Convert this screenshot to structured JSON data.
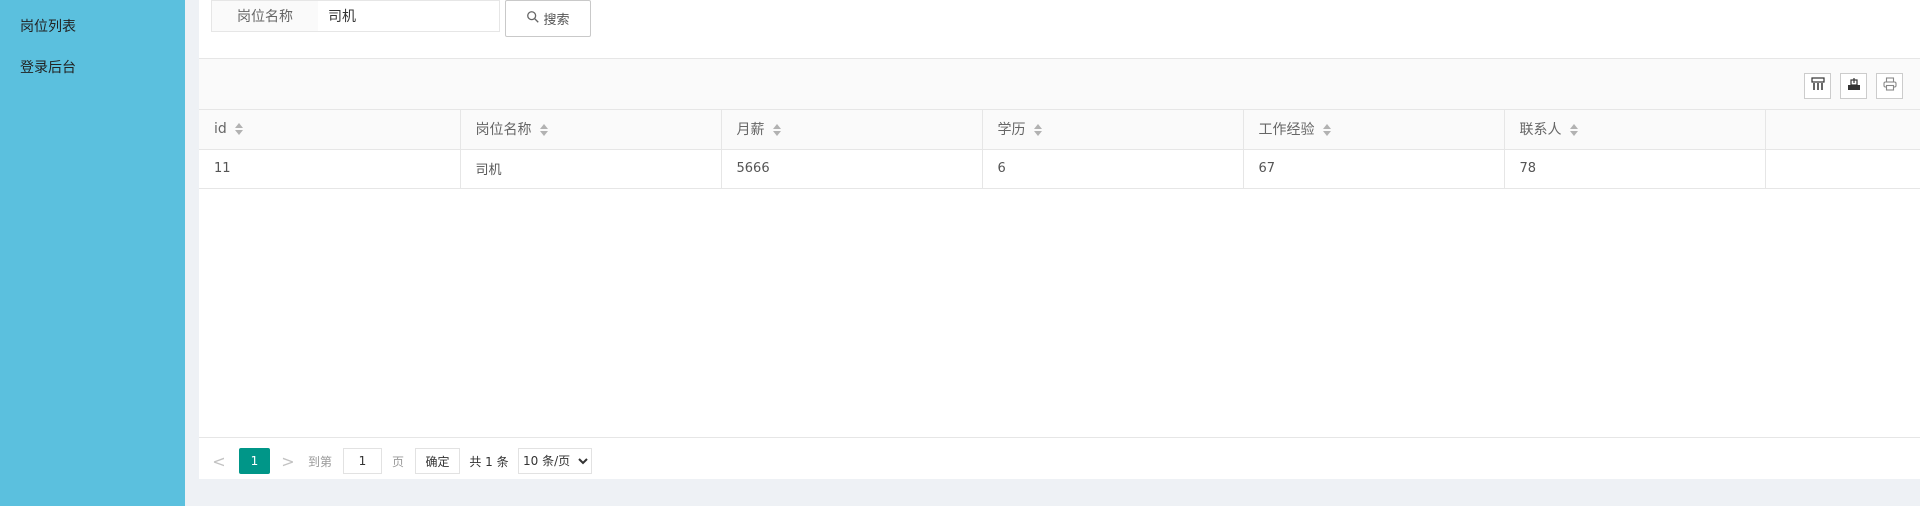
{
  "sidebar": {
    "items": [
      {
        "label": "岗位列表"
      },
      {
        "label": "登录后台"
      }
    ]
  },
  "search": {
    "label": "岗位名称",
    "value": "司机",
    "button_label": "搜索"
  },
  "toolbar": {
    "icons": [
      "columns-filter-icon",
      "export-icon",
      "print-icon"
    ]
  },
  "table": {
    "columns": [
      "id",
      "岗位名称",
      "月薪",
      "学历",
      "工作经验",
      "联系人",
      ""
    ],
    "rows": [
      [
        "11",
        "司机",
        "5666",
        "6",
        "67",
        "78",
        ""
      ]
    ]
  },
  "pagination": {
    "prev": "<",
    "current_page": "1",
    "next": ">",
    "goto_label": "到第",
    "goto_value": "1",
    "page_unit": "页",
    "confirm_label": "确定",
    "total_label": "共 1 条",
    "page_size_options": [
      "10 条/页"
    ],
    "page_size_selected": "10 条/页"
  },
  "colors": {
    "sidebar_bg": "#5bc0de",
    "accent": "#009688",
    "page_bg": "#eef1f5"
  }
}
